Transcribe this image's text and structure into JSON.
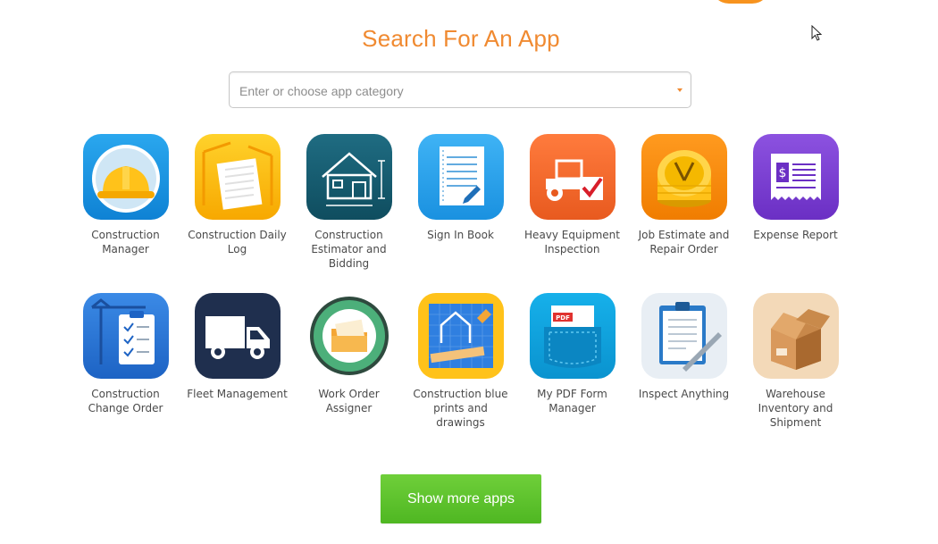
{
  "title": "Search For An App",
  "search": {
    "placeholder": "Enter or choose app category"
  },
  "apps": [
    {
      "label": "Construction Manager",
      "icon": "hard-hat-icon"
    },
    {
      "label": "Construction Daily Log",
      "icon": "daily-log-icon"
    },
    {
      "label": "Construction Estimator and Bidding",
      "icon": "house-blueprint-icon"
    },
    {
      "label": "Sign In Book",
      "icon": "notebook-pen-icon"
    },
    {
      "label": "Heavy Equipment Inspection",
      "icon": "tractor-check-icon"
    },
    {
      "label": "Job Estimate and Repair Order",
      "icon": "coins-tools-icon"
    },
    {
      "label": "Expense Report",
      "icon": "receipt-icon"
    },
    {
      "label": "Construction Change Order",
      "icon": "clipboard-crane-icon"
    },
    {
      "label": "Fleet Management",
      "icon": "truck-icon"
    },
    {
      "label": "Work Order Assigner",
      "icon": "folder-cycle-icon"
    },
    {
      "label": "Construction blue prints and drawings",
      "icon": "blueprint-ruler-icon"
    },
    {
      "label": "My PDF Form Manager",
      "icon": "pdf-pocket-icon"
    },
    {
      "label": "Inspect Anything",
      "icon": "inspect-clipboard-icon"
    },
    {
      "label": "Warehouse Inventory and Shipment",
      "icon": "box-icon"
    }
  ],
  "show_more": {
    "label": "Show more apps"
  },
  "colors": {
    "accent": "#f08a31",
    "button": "#5bbf2a"
  }
}
